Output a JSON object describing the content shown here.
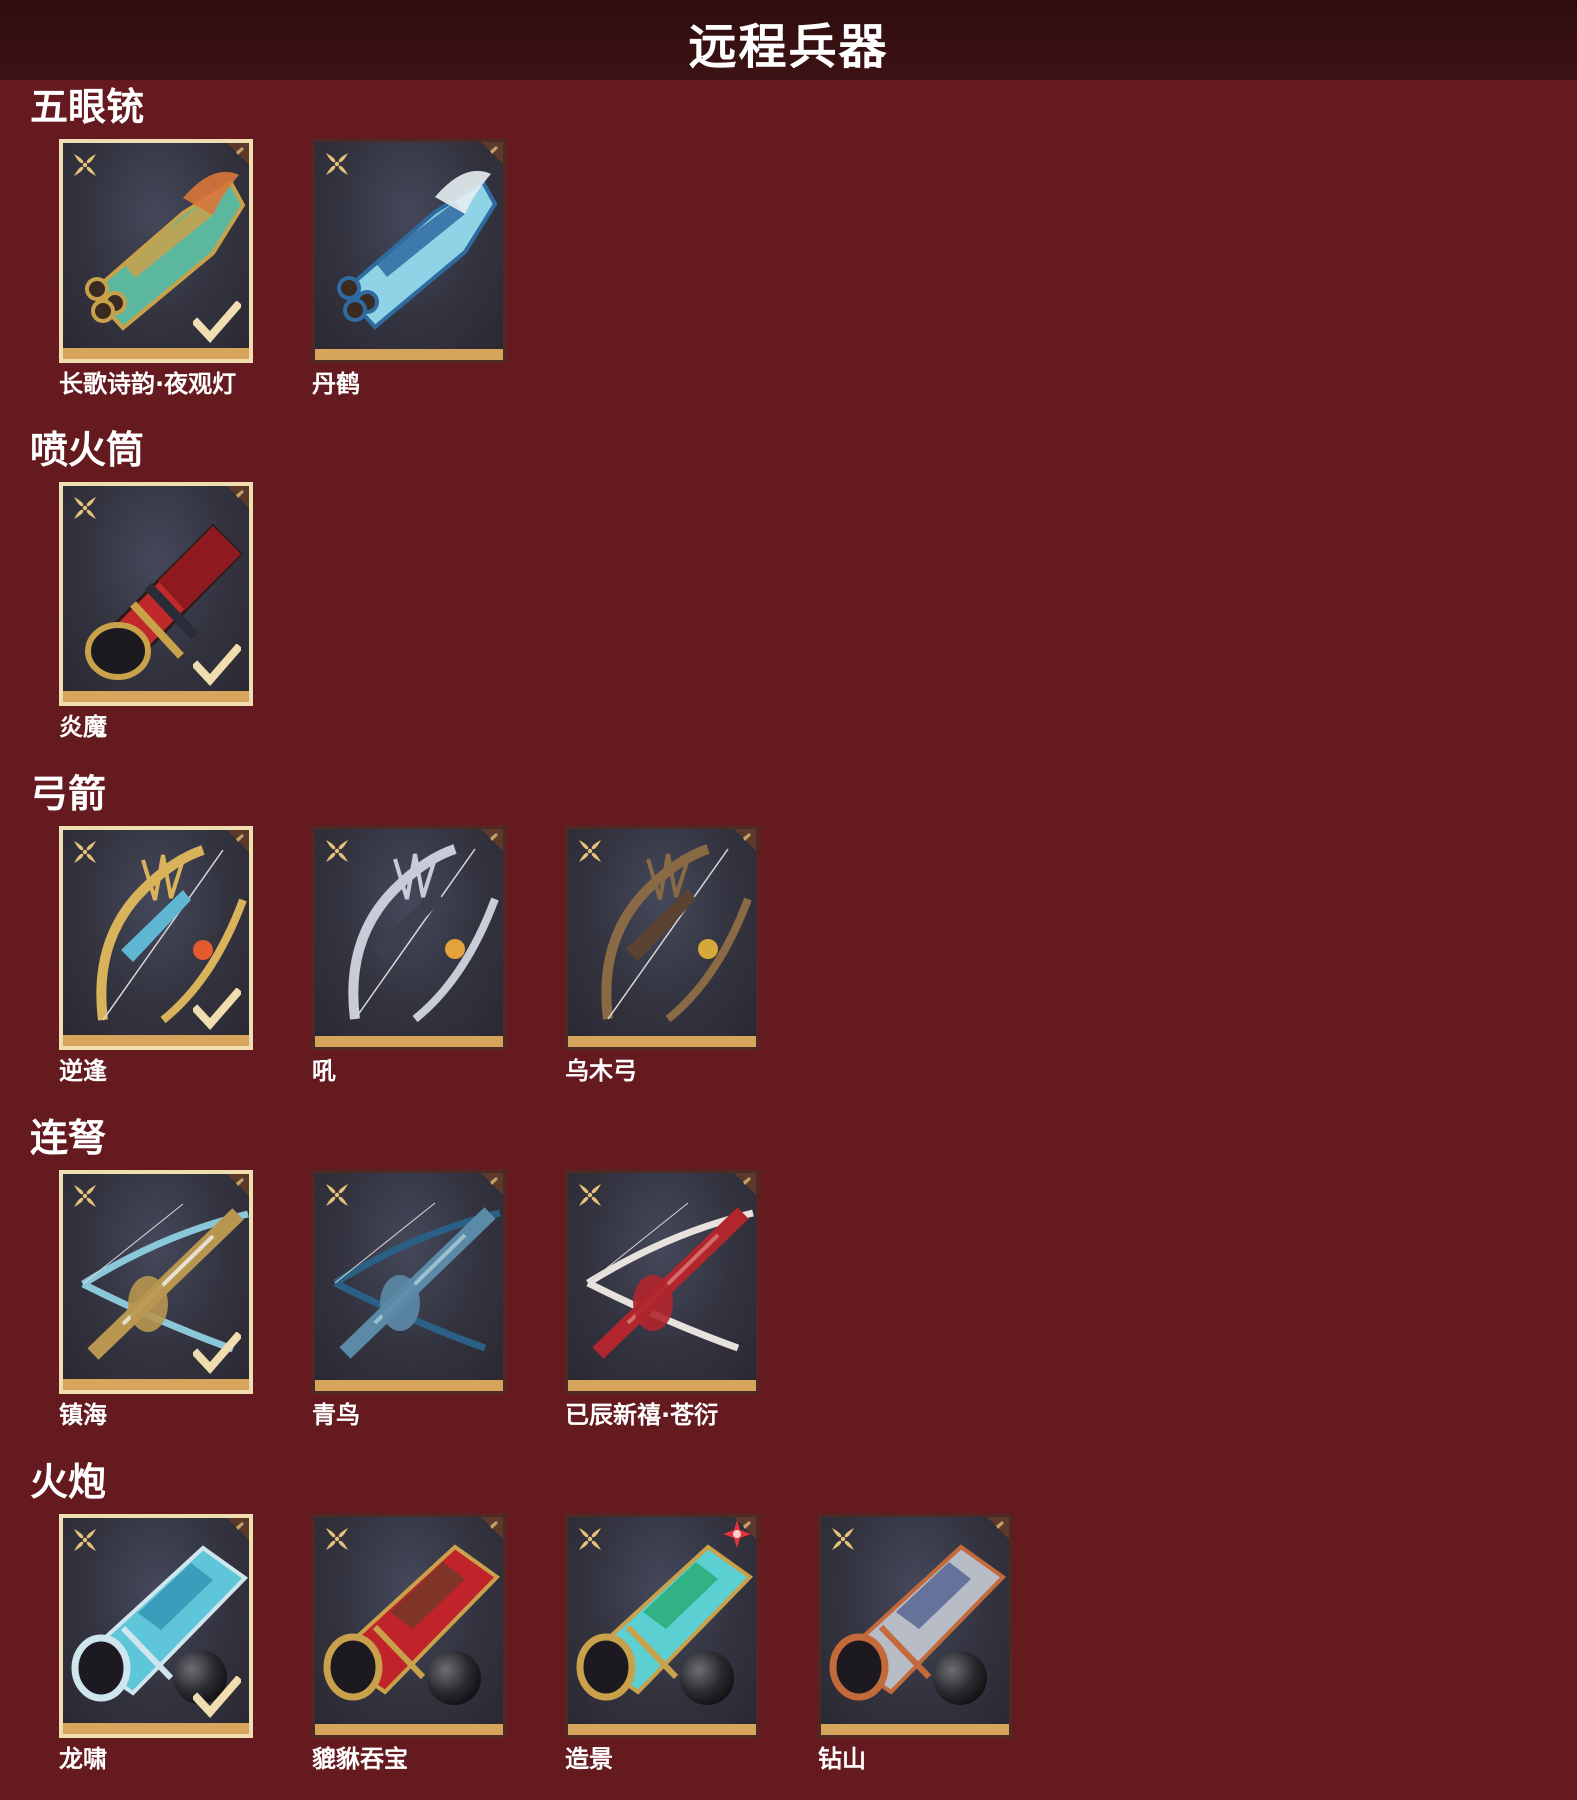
{
  "page": {
    "title": "远程兵器"
  },
  "colors": {
    "background": "#641a1e",
    "title_bar": "#2e0d0f",
    "selected_frame": "#f1deb0",
    "card_strip": "#d7a45b"
  },
  "sections": [
    {
      "title": "五眼铳",
      "items": [
        {
          "name": "长歌诗韵·夜观灯",
          "selected": true,
          "icon": "green-gold-gun-icon"
        },
        {
          "name": "丹鹤",
          "selected": false,
          "icon": "blue-white-gun-icon"
        }
      ]
    },
    {
      "title": "喷火筒",
      "items": [
        {
          "name": "炎魔",
          "selected": true,
          "icon": "red-flame-tube-icon"
        }
      ]
    },
    {
      "title": "弓箭",
      "items": [
        {
          "name": "逆逢",
          "selected": true,
          "icon": "gold-blue-bow-icon"
        },
        {
          "name": "吼",
          "selected": false,
          "icon": "dark-silver-bow-icon"
        },
        {
          "name": "乌木弓",
          "selected": false,
          "icon": "wooden-bow-icon"
        }
      ]
    },
    {
      "title": "连弩",
      "items": [
        {
          "name": "镇海",
          "selected": true,
          "icon": "gold-crossbow-icon"
        },
        {
          "name": "青鸟",
          "selected": false,
          "icon": "blue-crossbow-icon"
        },
        {
          "name": "已辰新禧·苍衍",
          "selected": false,
          "icon": "red-white-crossbow-icon"
        }
      ]
    },
    {
      "title": "火炮",
      "items": [
        {
          "name": "龙啸",
          "selected": true,
          "icon": "dragon-cannon-icon",
          "ball": true
        },
        {
          "name": "貔貅吞宝",
          "selected": false,
          "icon": "red-gold-cannon-icon",
          "ball": true
        },
        {
          "name": "造景",
          "selected": false,
          "icon": "turquoise-cannon-icon",
          "ball": true,
          "badge": true
        },
        {
          "name": "钻山",
          "selected": false,
          "icon": "silver-cannon-icon",
          "ball": true
        }
      ]
    }
  ]
}
